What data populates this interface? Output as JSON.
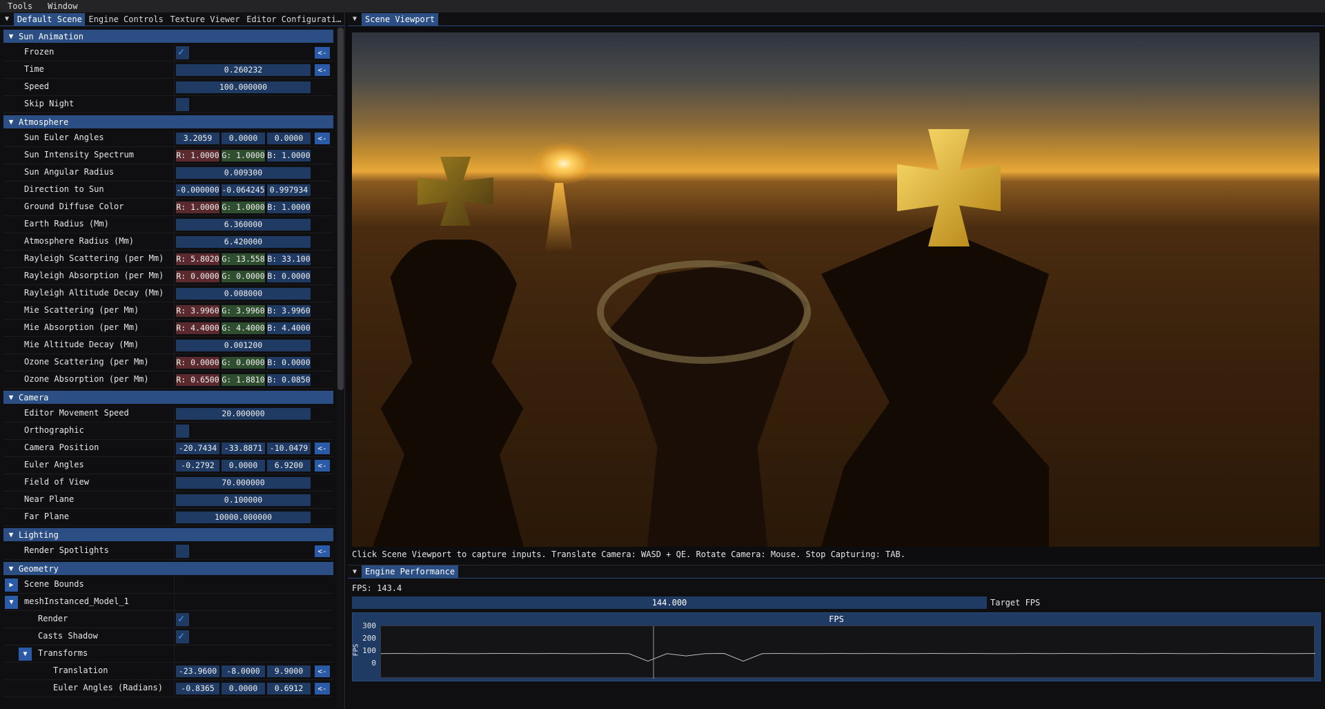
{
  "menubar": {
    "items": [
      "Tools",
      "Window"
    ]
  },
  "left_tabs": [
    "Default Scene",
    "Engine Controls",
    "Texture Viewer",
    "Editor Configurati…"
  ],
  "sections": {
    "sun": {
      "title": "Sun Animation",
      "frozen": "Frozen",
      "time": "Time",
      "time_val": "0.260232",
      "speed": "Speed",
      "speed_val": "100.000000",
      "skip": "Skip Night"
    },
    "atmo": {
      "title": "Atmosphere",
      "rows": [
        {
          "label": "Sun Euler Angles",
          "vals": [
            "3.2059",
            "0.0000",
            "0.0000"
          ]
        },
        {
          "label": "Sun Intensity Spectrum",
          "vals": [
            "R: 1.0000",
            "G: 1.0000",
            "B: 1.0000"
          ]
        },
        {
          "label": "Sun Angular Radius",
          "vals": [
            "0.009300"
          ]
        },
        {
          "label": "Direction to Sun",
          "vals": [
            "-0.000000",
            "-0.064245",
            "0.997934"
          ]
        },
        {
          "label": "Ground Diffuse Color",
          "vals": [
            "R: 1.0000",
            "G: 1.0000",
            "B: 1.0000"
          ]
        },
        {
          "label": "Earth Radius (Mm)",
          "vals": [
            "6.360000"
          ]
        },
        {
          "label": "Atmosphere Radius (Mm)",
          "vals": [
            "6.420000"
          ]
        },
        {
          "label": "Rayleigh Scattering (per Mm)",
          "vals": [
            "R: 5.8020",
            "G: 13.558",
            "B: 33.100"
          ]
        },
        {
          "label": "Rayleigh Absorption (per Mm)",
          "vals": [
            "R: 0.0000",
            "G: 0.0000",
            "B: 0.0000"
          ]
        },
        {
          "label": "Rayleigh Altitude Decay (Mm)",
          "vals": [
            "0.008000"
          ]
        },
        {
          "label": "Mie Scattering (per Mm)",
          "vals": [
            "R: 3.9960",
            "G: 3.9960",
            "B: 3.9960"
          ]
        },
        {
          "label": "Mie Absorption (per Mm)",
          "vals": [
            "R: 4.4000",
            "G: 4.4000",
            "B: 4.4000"
          ]
        },
        {
          "label": "Mie Altitude Decay (Mm)",
          "vals": [
            "0.001200"
          ]
        },
        {
          "label": "Ozone Scattering (per Mm)",
          "vals": [
            "R: 0.0000",
            "G: 0.0000",
            "B: 0.0000"
          ]
        },
        {
          "label": "Ozone Absorption (per Mm)",
          "vals": [
            "R: 0.6500",
            "G: 1.8810",
            "B: 0.0850"
          ]
        }
      ]
    },
    "camera": {
      "title": "Camera",
      "move": "Editor Movement Speed",
      "move_val": "20.000000",
      "ortho": "Orthographic",
      "pos": "Camera Position",
      "pos_vals": [
        "-20.7434",
        "-33.8871",
        "-10.0479"
      ],
      "euler": "Euler Angles",
      "euler_vals": [
        "-0.2792",
        "0.0000",
        "6.9200"
      ],
      "fov": "Field of View",
      "fov_val": "70.000000",
      "near": "Near Plane",
      "near_val": "0.100000",
      "far": "Far Plane",
      "far_val": "10000.000000"
    },
    "lighting": {
      "title": "Lighting",
      "spot": "Render Spotlights"
    },
    "geometry": {
      "title": "Geometry",
      "bounds": "Scene Bounds",
      "mesh": "meshInstanced_Model_1",
      "render": "Render",
      "casts": "Casts Shadow",
      "transforms": "Transforms",
      "trans": "Translation",
      "trans_vals": [
        "-23.9600",
        "-8.0000",
        "9.9000"
      ],
      "erad": "Euler Angles (Radians)",
      "erad_vals": [
        "-0.8365",
        "0.0000",
        "0.6912"
      ]
    }
  },
  "reset_label": "<-",
  "viewport": {
    "tab": "Scene Viewport",
    "status": "Click Scene Viewport to capture inputs. Translate Camera: WASD + QE. Rotate Camera: Mouse. Stop Capturing: TAB."
  },
  "perf": {
    "tab": "Engine Performance",
    "fps_text": "FPS: 143.4",
    "target_value": "144.000",
    "target_label": "Target FPS",
    "graph_title": "FPS",
    "ylabel": "FPS"
  },
  "chart_data": {
    "type": "line",
    "title": "FPS",
    "ylabel": "FPS",
    "ylim": [
      0,
      300
    ],
    "yticks": [
      "300",
      "200",
      "100",
      "0"
    ],
    "series": [
      {
        "values": [
          143,
          144,
          143,
          144,
          143,
          143,
          144,
          144,
          143,
          144,
          143,
          143,
          144,
          143,
          100,
          143,
          130,
          143,
          144,
          100,
          143,
          144,
          143,
          143,
          144,
          143,
          144,
          143,
          143,
          144,
          143,
          144,
          143,
          143,
          144,
          143,
          144,
          143,
          143,
          144,
          143,
          144,
          143,
          143,
          144,
          143,
          144,
          143,
          143,
          144
        ]
      }
    ],
    "grid": false
  }
}
